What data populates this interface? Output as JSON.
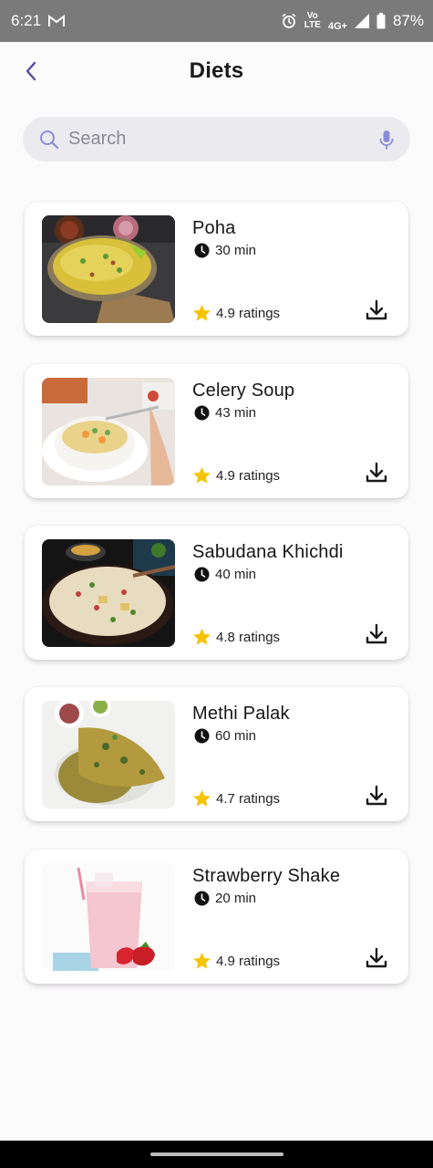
{
  "status_bar": {
    "time": "6:21",
    "battery": "87%",
    "network_label": "4G+",
    "volte_top": "Vo",
    "volte_bottom": "LTE",
    "icons": [
      "gmail-icon",
      "alarm-icon",
      "signal-icon",
      "battery-icon"
    ]
  },
  "header": {
    "title": "Diets",
    "back_icon": "chevron-left-icon",
    "accent_color": "#5a4a9a"
  },
  "search": {
    "placeholder": "Search",
    "value": "",
    "icon_color": "#7a7dd8"
  },
  "diets": [
    {
      "name": "Poha",
      "time": "30 min",
      "rating": "4.9 ratings",
      "image": "poha-photo"
    },
    {
      "name": "Celery Soup",
      "time": "43 min",
      "rating": "4.9 ratings",
      "image": "celery-soup-photo"
    },
    {
      "name": "Sabudana Khichdi",
      "time": "40 min",
      "rating": "4.8 ratings",
      "image": "sabudana-khichdi-photo"
    },
    {
      "name": "Methi Palak",
      "time": "60 min",
      "rating": "4.7 ratings",
      "image": "methi-palak-photo"
    },
    {
      "name": "Strawberry Shake",
      "time": "20 min",
      "rating": "4.9 ratings",
      "image": "strawberry-shake-photo"
    }
  ],
  "colors": {
    "star": "#f5c400",
    "text": "#161616",
    "background": "#fcfbfc"
  }
}
